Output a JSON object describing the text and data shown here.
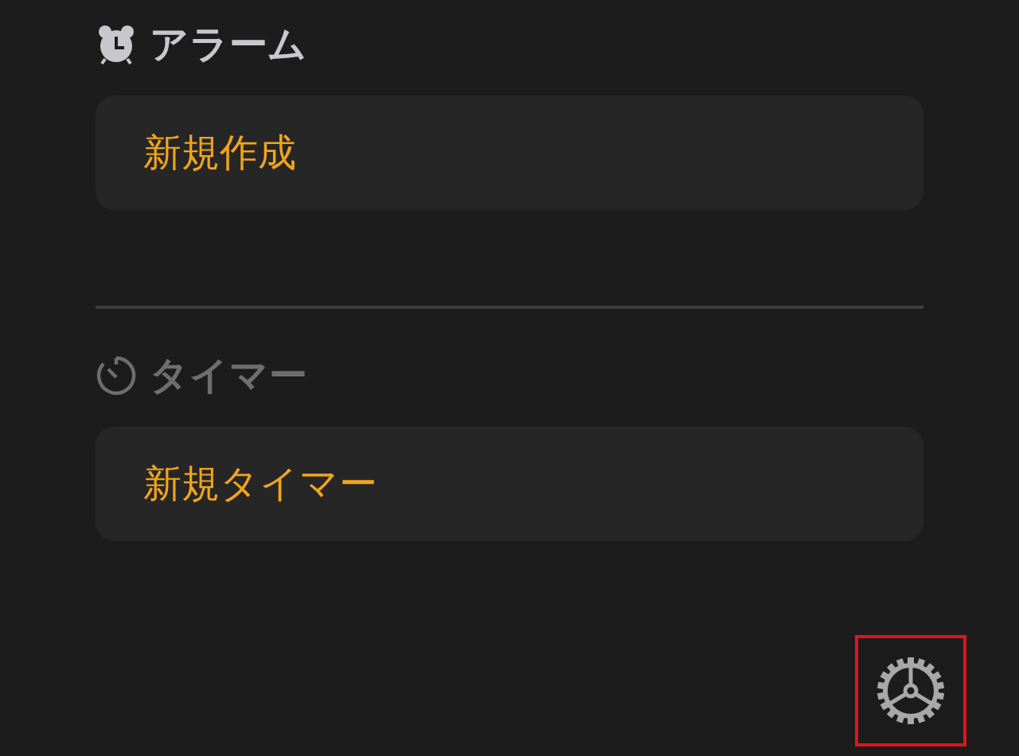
{
  "sections": [
    {
      "kind": "alarm",
      "title": "アラーム",
      "dimmed": false,
      "action": "新規作成"
    },
    {
      "kind": "timer",
      "title": "タイマー",
      "dimmed": true,
      "action": "新規タイマー"
    }
  ],
  "settings_button": {
    "highlighted": true
  }
}
